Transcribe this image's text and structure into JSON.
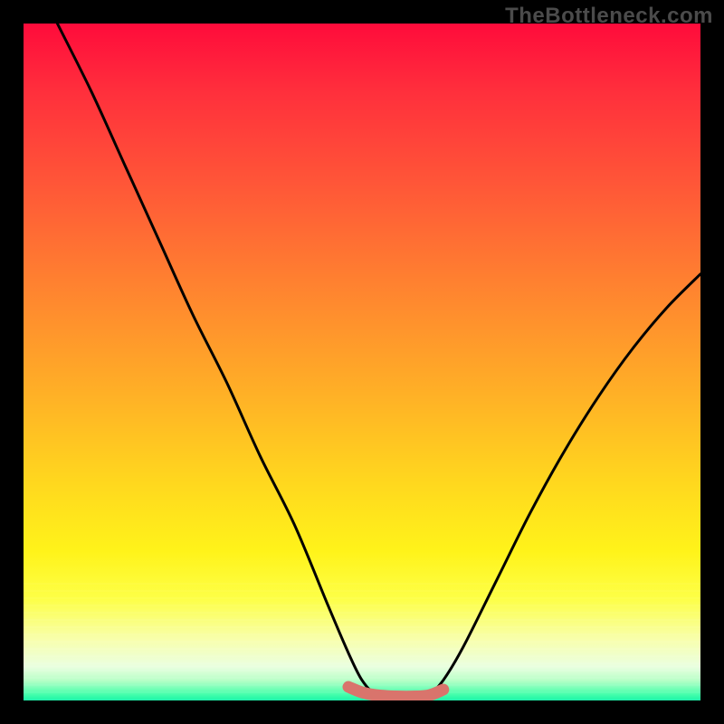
{
  "watermark": "TheBottleneck.com",
  "chart_data": {
    "type": "line",
    "title": "",
    "xlabel": "",
    "ylabel": "",
    "xlim": [
      0,
      100
    ],
    "ylim": [
      0,
      100
    ],
    "grid": false,
    "legend": false,
    "series": [
      {
        "name": "bottleneck-curve",
        "color": "#000000",
        "x": [
          5,
          10,
          15,
          20,
          25,
          30,
          35,
          40,
          45,
          48,
          50,
          52,
          55,
          58,
          60,
          62,
          65,
          70,
          75,
          80,
          85,
          90,
          95,
          100
        ],
        "values": [
          100,
          90,
          79,
          68,
          57,
          47,
          36,
          26,
          14,
          7,
          3,
          1,
          0.5,
          0.5,
          1,
          3,
          8,
          18,
          28,
          37,
          45,
          52,
          58,
          63
        ]
      },
      {
        "name": "bottleneck-marker",
        "color": "#d9746c",
        "x": [
          48,
          50,
          52,
          55,
          58,
          60,
          62
        ],
        "values": [
          2.0,
          1.2,
          0.8,
          0.6,
          0.6,
          0.8,
          1.6
        ]
      }
    ],
    "annotations": []
  }
}
